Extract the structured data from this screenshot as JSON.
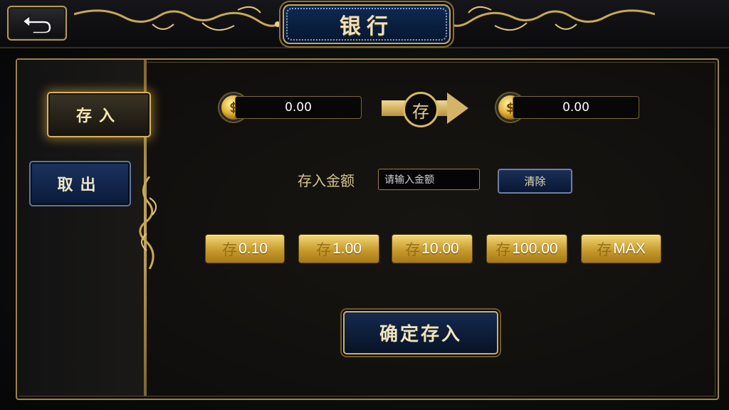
{
  "header": {
    "title": "银行"
  },
  "sidebar": {
    "items": [
      {
        "label": "存入",
        "active": true
      },
      {
        "label": "取出",
        "active": false
      }
    ]
  },
  "transfer": {
    "coin_balance": "0.00",
    "bank_balance": "0.00",
    "arrow_label": "存",
    "bank_icon_glyph": "$"
  },
  "deposit_form": {
    "label": "存入金额",
    "placeholder": "请输入金额",
    "clear_label": "清除"
  },
  "quick_amounts": [
    {
      "prefix": "存",
      "value": "0.10"
    },
    {
      "prefix": "存",
      "value": "1.00"
    },
    {
      "prefix": "存",
      "value": "10.00"
    },
    {
      "prefix": "存",
      "value": "100.00"
    },
    {
      "prefix": "存",
      "value": "MAX"
    }
  ],
  "confirm_label": "确定存入",
  "colors": {
    "gold": "#d5b467",
    "navy": "#0d2a52"
  }
}
